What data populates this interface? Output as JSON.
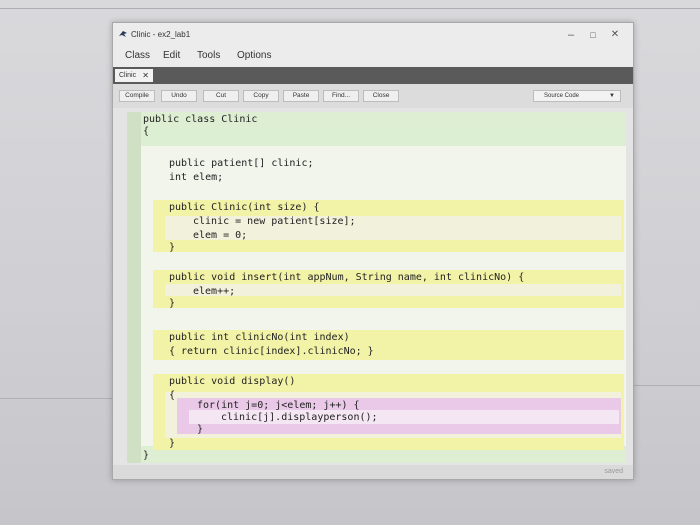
{
  "window": {
    "title": "Clinic - ex2_lab1",
    "controls": {
      "minimize": "–",
      "maximize": "□",
      "close": "✕"
    }
  },
  "menu": [
    "Class",
    "Edit",
    "Tools",
    "Options"
  ],
  "tabs": [
    {
      "label": "Clinic",
      "close": "✕"
    }
  ],
  "toolbar": {
    "buttons": [
      "Compile",
      "Undo",
      "Cut",
      "Copy",
      "Paste",
      "Find...",
      "Close"
    ],
    "view_mode": "Source Code"
  },
  "code": {
    "class_decl": "public class Clinic",
    "open_brace": "{",
    "field1": "public patient[] clinic;",
    "field2": "int elem;",
    "ctor_sig": "public Clinic(int size) {",
    "ctor_l1": "clinic = new patient[size];",
    "ctor_l2": "elem = 0;",
    "ctor_close": "}",
    "insert_sig": "public void insert(int appNum, String name, int clinicNo) {",
    "insert_l1": "elem++;",
    "insert_close": "}",
    "cno_sig": "public int clinicNo(int index)",
    "cno_body": "{ return clinic[index].clinicNo; }",
    "disp_sig": "public void display()",
    "disp_open": "{",
    "for_sig": "for(int j=0; j<elem; j++) {",
    "for_body": "clinic[j].displayperson();",
    "for_close": "}",
    "disp_close": "}",
    "class_close": "}"
  },
  "status": "saved",
  "colors": {
    "class_scope": "#dcefd2",
    "method_scope": "#f3f3a8",
    "method_inner": "#f2f1dc",
    "loop_scope": "#eac8e8",
    "loop_inner": "#f4e6f2"
  }
}
